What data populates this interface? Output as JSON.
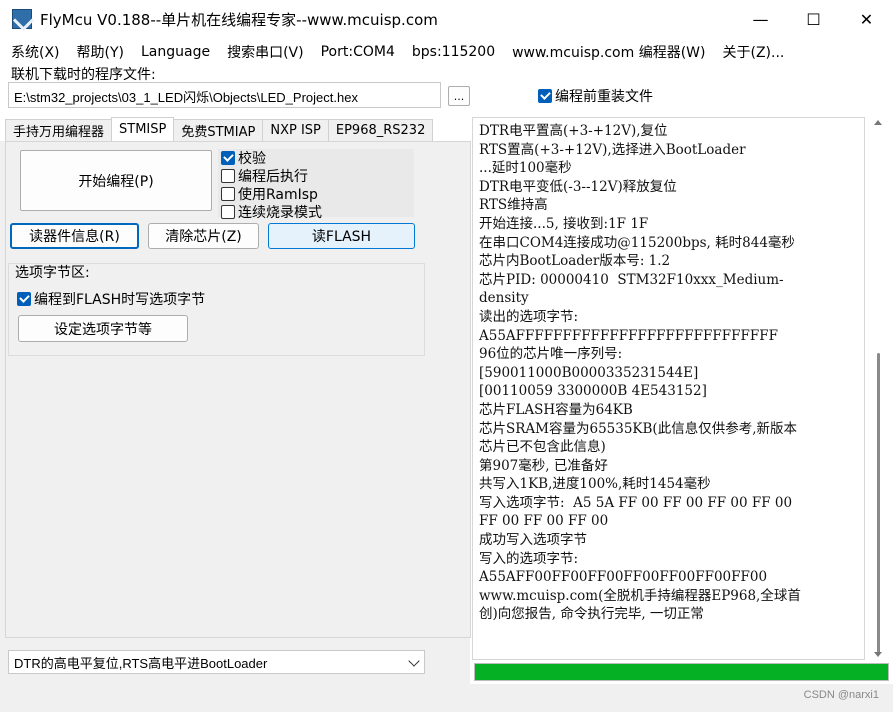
{
  "window": {
    "title": "FlyMcu V0.188--单片机在线编程专家--www.mcuisp.com",
    "minimize": "—",
    "maximize": "☐",
    "close": "✕"
  },
  "menu": [
    "系统(X)",
    "帮助(Y)",
    "Language",
    "搜索串口(V)",
    "Port:COM4",
    "bps:115200",
    "www.mcuisp.com 编程器(W)",
    "关于(Z)..."
  ],
  "file": {
    "label": "联机下载时的程序文件:",
    "path": "E:\\stm32_projects\\03_1_LED闪烁\\Objects\\LED_Project.hex",
    "browse_label": "...",
    "reload_label": "编程前重装文件",
    "reload_checked": true
  },
  "tabs": [
    "手持万用编程器",
    "STMISP",
    "免费STMIAP",
    "NXP ISP",
    "EP968_RS232"
  ],
  "active_tab": 1,
  "stmisp": {
    "start_button": "开始编程(P)",
    "options": [
      {
        "label": "校验",
        "checked": true
      },
      {
        "label": "编程后执行",
        "checked": false
      },
      {
        "label": "使用RamIsp",
        "checked": false
      },
      {
        "label": "连续烧录模式",
        "checked": false
      }
    ],
    "read_info_button": "读器件信息(R)",
    "erase_button": "清除芯片(Z)",
    "read_flash_button": "读FLASH",
    "option_bytes": {
      "title": "选项字节区:",
      "write_label": "编程到FLASH时写选项字节",
      "write_checked": true,
      "set_button": "设定选项字节等"
    }
  },
  "reset_mode": "DTR的高电平复位,RTS高电平进BootLoader",
  "log": [
    "DTR电平置高(+3-+12V),复位",
    "RTS置高(+3-+12V),选择进入BootLoader",
    "...延时100毫秒",
    "DTR电平变低(-3--12V)释放复位",
    "RTS维持高",
    "开始连接...5, 接收到:1F 1F",
    "在串口COM4连接成功@115200bps, 耗时844毫秒",
    "芯片内BootLoader版本号: 1.2",
    "芯片PID: 00000410  STM32F10xxx_Medium-",
    "density",
    "读出的选项字节:",
    "A55AFFFFFFFFFFFFFFFFFFFFFFFFFFFF",
    "96位的芯片唯一序列号:",
    "[590011000B0000335231544E]",
    "[00110059 3300000B 4E543152]",
    "芯片FLASH容量为64KB",
    "芯片SRAM容量为65535KB(此信息仅供参考,新版本",
    "芯片已不包含此信息)",
    "第907毫秒, 已准备好",
    "共写入1KB,进度100%,耗时1454毫秒",
    "写入选项字节:  A5 5A FF 00 FF 00 FF 00 FF 00",
    "FF 00 FF 00 FF 00",
    "成功写入选项字节",
    "写入的选项字节:",
    "A55AFF00FF00FF00FF00FF00FF00FF00",
    "www.mcuisp.com(全脱机手持编程器EP968,全球首",
    "创)向您报告, 命令执行完毕, 一切正常"
  ],
  "progress": {
    "percent": 100,
    "color": "#06b025"
  },
  "watermark": "CSDN @narxi1",
  "colors": {
    "accent": "#005fb8",
    "progress": "#06b025"
  }
}
